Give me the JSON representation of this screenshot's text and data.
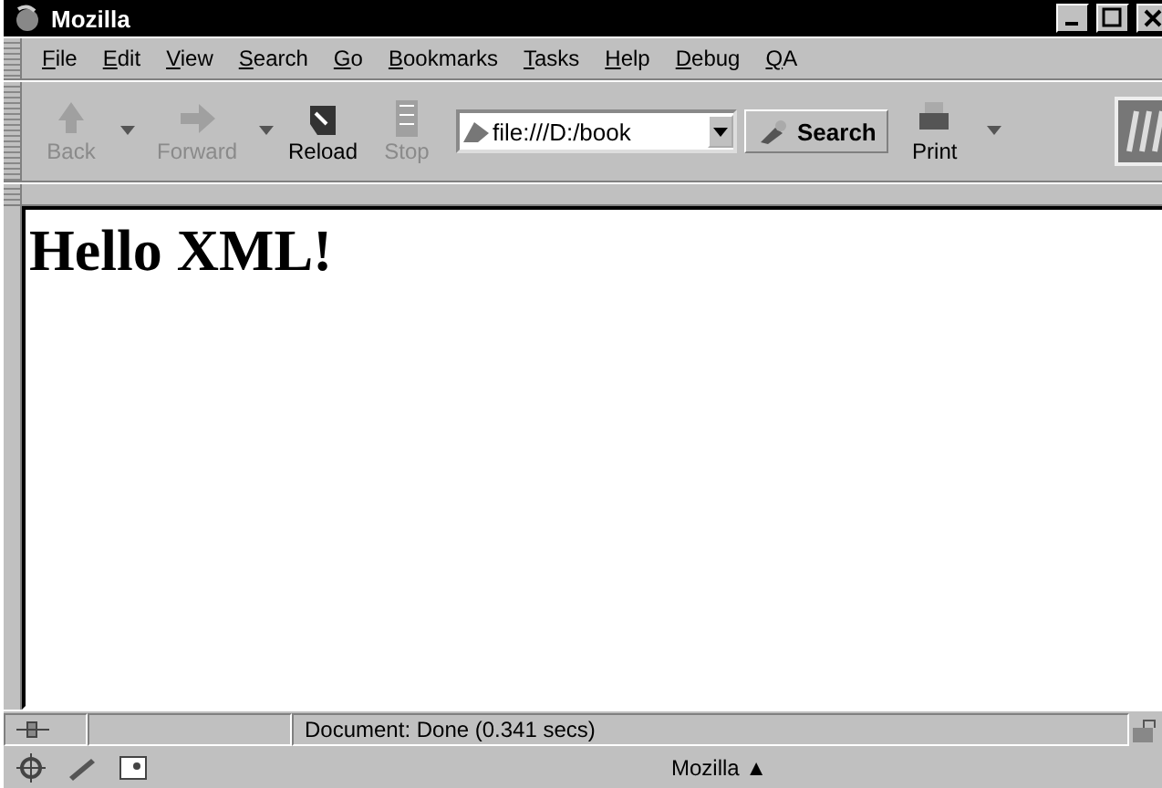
{
  "window": {
    "title": "Mozilla"
  },
  "menu": [
    "File",
    "Edit",
    "View",
    "Search",
    "Go",
    "Bookmarks",
    "Tasks",
    "Help",
    "Debug",
    "QA"
  ],
  "toolbar": [
    {
      "kind": "back",
      "label": "Back",
      "disabled": true
    },
    {
      "kind": "forward",
      "label": "Forward",
      "disabled": true
    },
    {
      "kind": "reload",
      "label": "Reload",
      "disabled": false
    },
    {
      "kind": "stop",
      "label": "Stop",
      "disabled": true
    }
  ],
  "address": {
    "value": "file:///D:/book"
  },
  "search_button": "Search",
  "print_button": "Print",
  "content": {
    "heading": "Hello XML!"
  },
  "status_bar": {
    "text": "Document: Done (0.341 secs)"
  },
  "component_bar": {
    "label": "Mozilla ▲"
  }
}
